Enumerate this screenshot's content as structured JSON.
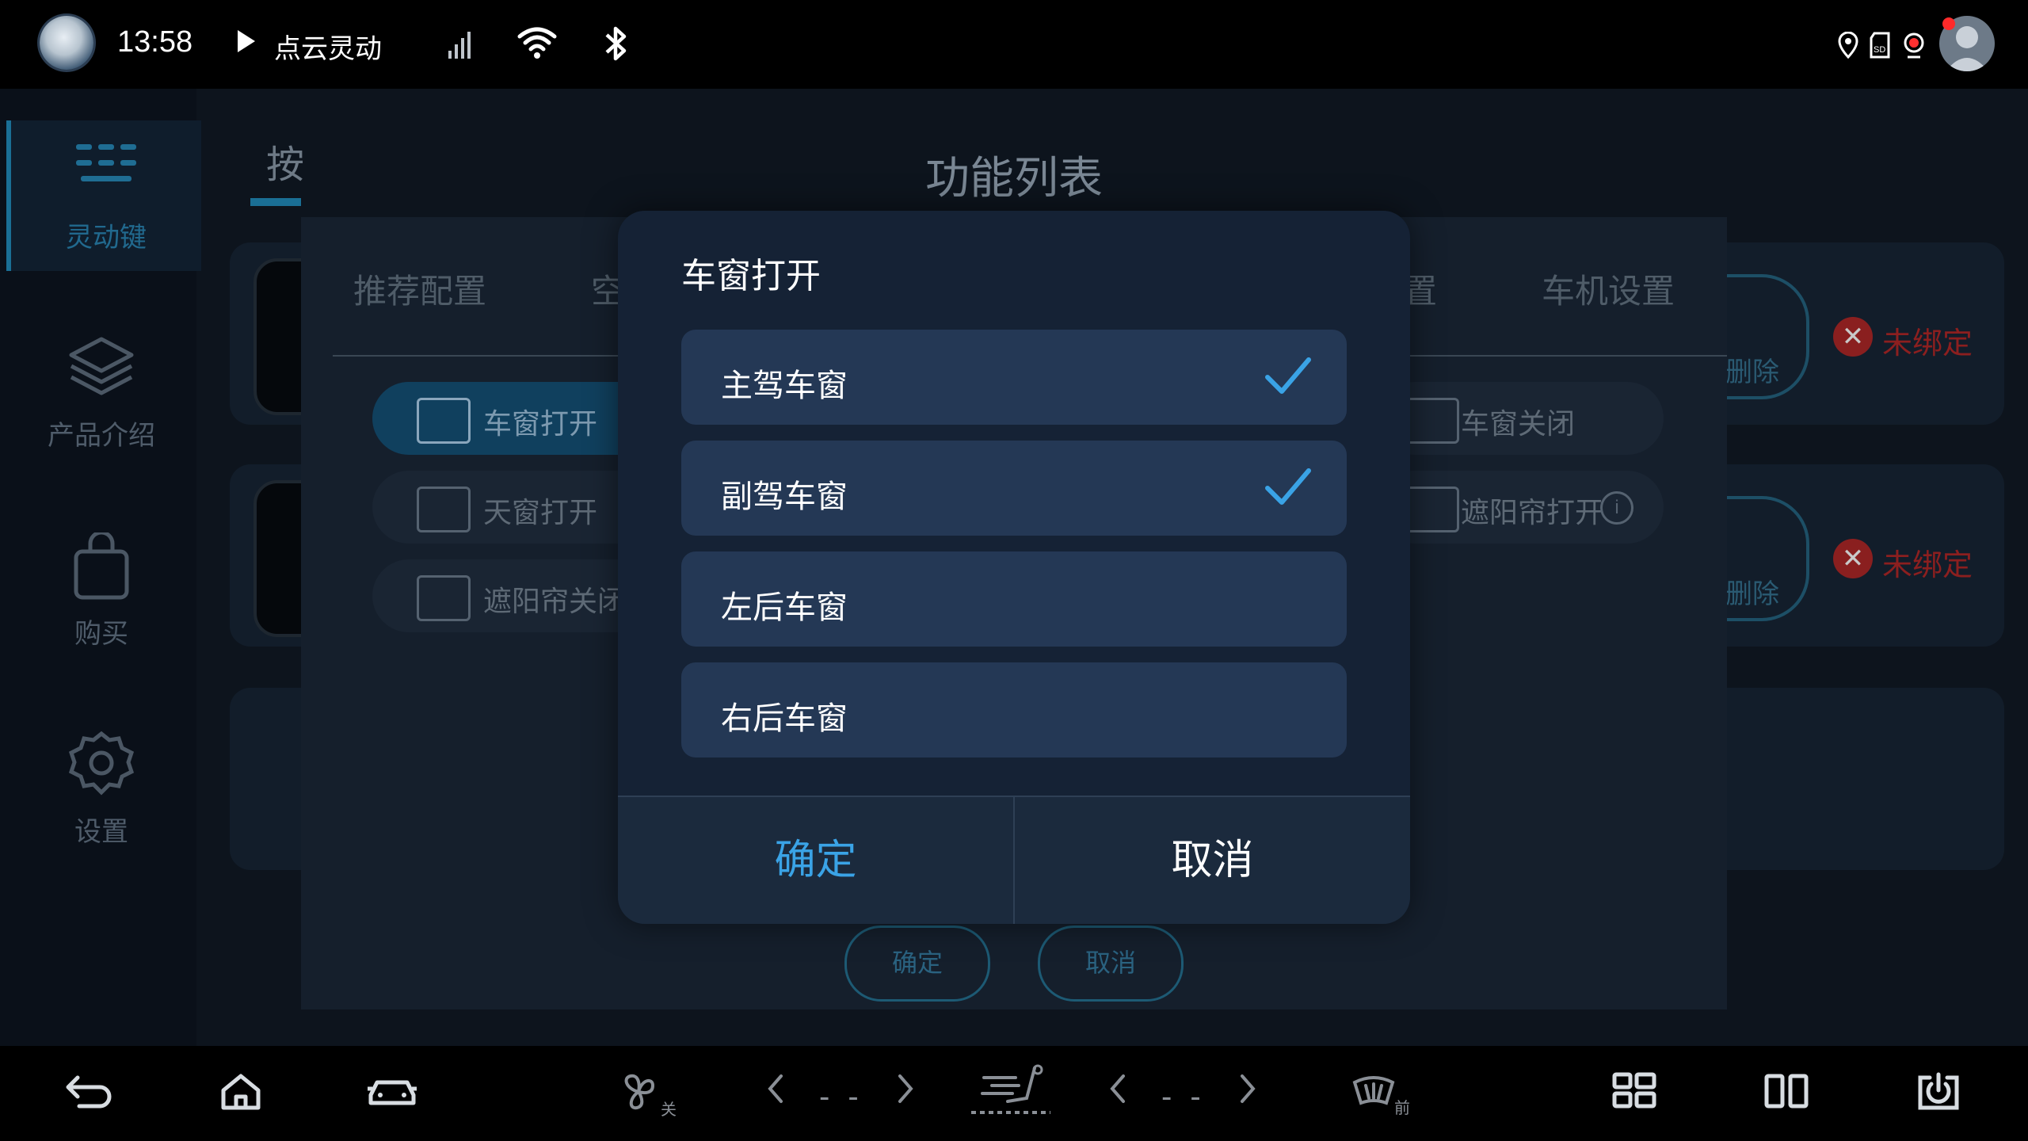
{
  "status_bar": {
    "time": "13:58",
    "now_playing": "点云灵动"
  },
  "sidebar": {
    "items": [
      {
        "label": "灵动键",
        "icon": "keypad-icon",
        "active": true
      },
      {
        "label": "产品介绍",
        "icon": "layers-icon",
        "active": false
      },
      {
        "label": "购买",
        "icon": "shopping-bag-icon",
        "active": false
      },
      {
        "label": "设置",
        "icon": "gear-icon",
        "active": false
      }
    ]
  },
  "background": {
    "tab_fragment": "按",
    "cards": [
      {
        "delete_label": "删除",
        "status": "未绑定"
      },
      {
        "delete_label": "删除",
        "status": "未绑定"
      }
    ]
  },
  "function_list": {
    "title": "功能列表",
    "tabs": [
      "推荐配置",
      "空",
      "置",
      "车机设置"
    ],
    "chips": [
      {
        "label": "车窗打开",
        "selected": true
      },
      {
        "label": "天窗打开",
        "selected": false
      },
      {
        "label": "遮阳帘关闭",
        "selected": false
      },
      {
        "label": "车窗关闭",
        "selected": false
      },
      {
        "label": "遮阳帘打开",
        "selected": false
      }
    ],
    "confirm_label": "确定",
    "cancel_label": "取消"
  },
  "dialog": {
    "title": "车窗打开",
    "options": [
      {
        "label": "主驾车窗",
        "checked": true
      },
      {
        "label": "副驾车窗",
        "checked": true
      },
      {
        "label": "左后车窗",
        "checked": false
      },
      {
        "label": "右后车窗",
        "checked": false
      }
    ],
    "confirm_label": "确定",
    "cancel_label": "取消"
  },
  "nav_bar": {
    "fan_state": "关",
    "left_temp": "- -",
    "right_temp": "- -",
    "defrost_label": "前"
  },
  "colors": {
    "accent": "#3aa3e6",
    "option_bg": "#243855",
    "dialog_bg": "#152235",
    "unbound_red": "#8c1f1f"
  }
}
